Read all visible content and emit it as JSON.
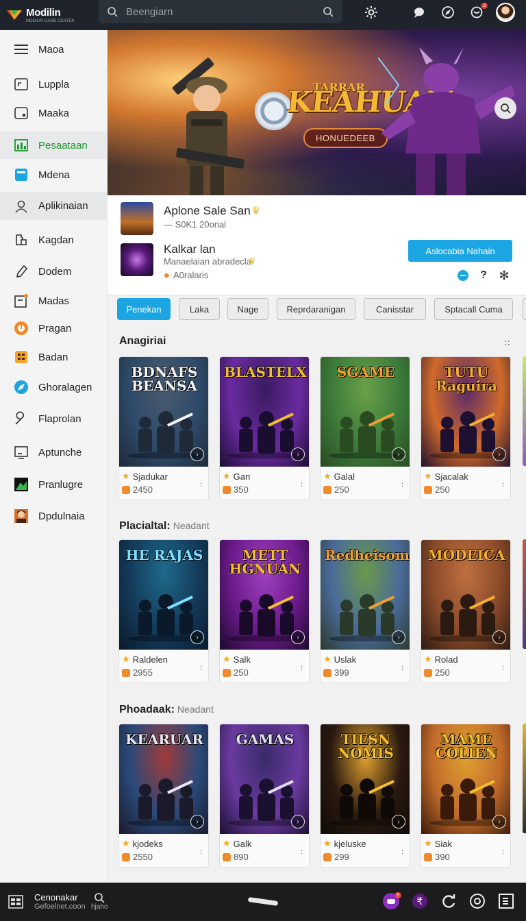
{
  "app": {
    "name": "Modilin",
    "tagline": "MODILIN GAME CENTER"
  },
  "search": {
    "placeholder": "Beengiarn"
  },
  "header": {
    "notification_count": "3"
  },
  "sidebar": {
    "items": [
      {
        "label": "Maoa",
        "icon": "menu-icon"
      },
      {
        "label": "Luppla",
        "icon": "window-icon"
      },
      {
        "label": "Maaka",
        "icon": "tablet-icon"
      },
      {
        "label": "Pesaataan",
        "icon": "chart-icon"
      },
      {
        "label": "Mdena",
        "icon": "app-blue-icon"
      },
      {
        "label": "Aplikinaian",
        "icon": "user-icon"
      },
      {
        "label": "Kagdan",
        "icon": "puzzle-icon"
      },
      {
        "label": "Dodem",
        "icon": "pen-icon"
      },
      {
        "label": "Madas",
        "icon": "frame-icon"
      },
      {
        "label": "Pragan",
        "icon": "orange-circle-icon"
      },
      {
        "label": "Badan",
        "icon": "grid-orange-icon"
      },
      {
        "label": "Ghoralagen",
        "icon": "compass-icon"
      },
      {
        "label": "Flaprolan",
        "icon": "wrench-icon"
      },
      {
        "label": "Aptunche",
        "icon": "monitor-icon"
      },
      {
        "label": "Pranlugre",
        "icon": "game-tile-icon"
      },
      {
        "label": "Dpdulnaia",
        "icon": "avatar-tile-icon"
      }
    ]
  },
  "hero": {
    "kicker": "TARRAR",
    "title": "KEAHUAH",
    "badge": "HONUEDEEB"
  },
  "featured": {
    "item1": {
      "title": "Aplone Sale San",
      "sub": "— S0K1 20onal"
    },
    "item2": {
      "title": "Kalkar lan",
      "sub": "Manaelaian abradecla",
      "meta": "A0ralaris"
    },
    "cta": "Aslocabia Nahain"
  },
  "chips": [
    "Penekan",
    "Laka",
    "Nage",
    "Reprdaranigan",
    "Canisstar",
    "Sptacall Cuma"
  ],
  "sections": [
    {
      "title": "Anagiriai",
      "muted": "",
      "more": "∷",
      "cards": [
        {
          "art": "BDNAFS BEANSA",
          "name": "Sjadukar",
          "price": "2450"
        },
        {
          "art": "BLASTELX",
          "name": "Gan",
          "price": "350"
        },
        {
          "art": "SGAME",
          "name": "Galal",
          "price": "250"
        },
        {
          "art": "TUTU Raguira",
          "name": "Sjacalak",
          "price": "250"
        }
      ]
    },
    {
      "title": "Placialtal:",
      "muted": "Neadant",
      "more": "",
      "cards": [
        {
          "art": "HE RAJAS",
          "name": "Raldelen",
          "price": "2955"
        },
        {
          "art": "METT HGNUAN",
          "name": "Salk",
          "price": "250"
        },
        {
          "art": "Redheisom",
          "name": "Uslak",
          "price": "399"
        },
        {
          "art": "MODEICA",
          "name": "Rolad",
          "price": "250"
        }
      ]
    },
    {
      "title": "Phoadaak:",
      "muted": "Neadant",
      "more": "",
      "cards": [
        {
          "art": "KEARUAR",
          "name": "kjodeks",
          "price": "2550"
        },
        {
          "art": "GAMAS",
          "name": "Galk",
          "price": "890"
        },
        {
          "art": "TIESN NOMIS",
          "name": "kjeluske",
          "price": "299"
        },
        {
          "art": "MAME COLIEN",
          "name": "Siak",
          "price": "390"
        }
      ]
    }
  ],
  "taskbar": {
    "title": "Cenonakar",
    "sub": "Gefoelnet.coon",
    "search_label": "hjaho",
    "badge": "9"
  },
  "colors": {
    "accent": "#1ba6e3",
    "active_nav": "#1a9a2c",
    "topbar": "#1f242c"
  }
}
